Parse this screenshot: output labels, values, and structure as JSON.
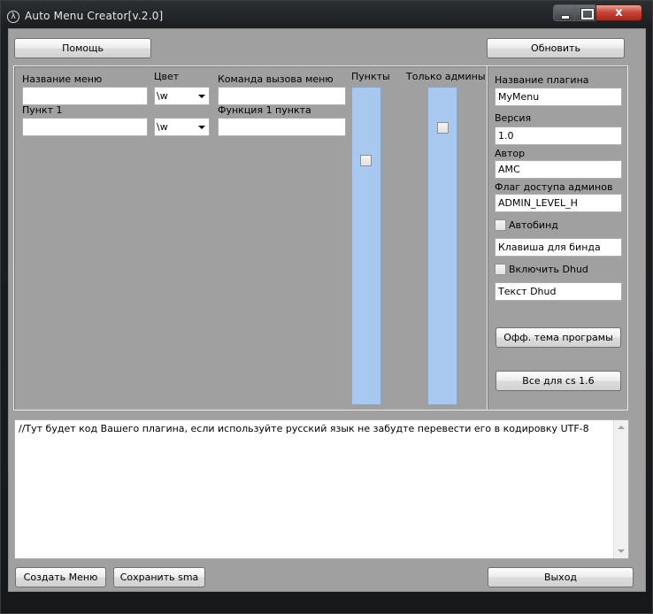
{
  "window": {
    "title": "Auto Menu Creator[v.2.0]",
    "close_label": "x"
  },
  "toolbar": {
    "help_label": "Помощь",
    "refresh_label": "Обновить"
  },
  "menu_panel": {
    "menu_name_label": "Название меню",
    "menu_name_value": "",
    "color_label": "Цвет",
    "color_value": "\\w",
    "command_label": "Команда вызова меню",
    "command_value": "",
    "item1_label": "Пункт 1",
    "item1_value": "",
    "item1_color_value": "\\w",
    "func1_label": "Функция 1 пункта",
    "func1_value": "",
    "items_header": "Пункты",
    "admins_only_header": "Только  админы"
  },
  "plugin_panel": {
    "plugin_name_label": "Название плагина",
    "plugin_name_value": "MyMenu",
    "version_label": "Версия",
    "version_value": "1.0",
    "author_label": "Автор",
    "author_value": "AMC",
    "admin_flag_label": "Флаг доступа админов",
    "admin_flag_value": "ADMIN_LEVEL_H",
    "autobind_label": "Автобинд",
    "bind_key_value": "Клавиша для бинда",
    "dhud_label": "Включить Dhud",
    "dhud_text_value": "Текст Dhud",
    "official_topic_label": "Офф. тема програмы",
    "all_for_cs_label": "Все для cs 1.6"
  },
  "code_area": {
    "text": "//Тут будет код Вашего плагина, если используйте русский язык не забудте перевести его в кодировку UTF-8"
  },
  "bottom": {
    "create_label": "Создать Меню",
    "save_label": "Сохранить sma",
    "exit_label": "Выход"
  }
}
